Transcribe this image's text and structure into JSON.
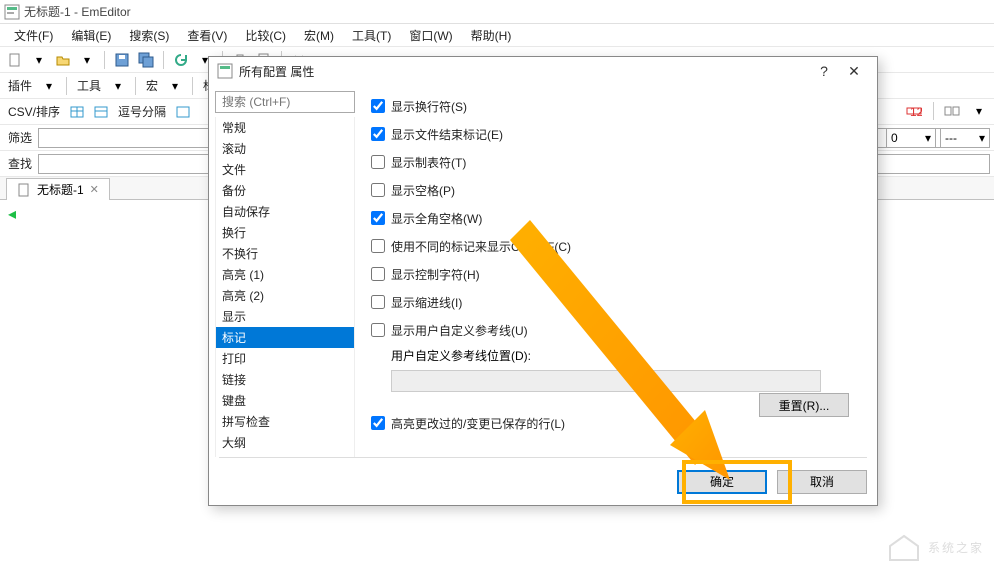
{
  "window": {
    "title": "无标题-1 - EmEditor"
  },
  "menu": {
    "items": [
      "文件(F)",
      "编辑(E)",
      "搜索(S)",
      "查看(V)",
      "比较(C)",
      "宏(M)",
      "工具(T)",
      "窗口(W)",
      "帮助(H)"
    ]
  },
  "toolbar2": {
    "plugins": "插件",
    "tools": "工具",
    "macro": "宏",
    "marker": "标"
  },
  "toolbar3": {
    "csv": "CSV/排序",
    "csvsep": "逗号分隔"
  },
  "toolbar4": {
    "filter": "筛选"
  },
  "toolbar5": {
    "find": "查找"
  },
  "tab": {
    "label": "无标题-1"
  },
  "right_widgets": {
    "num": "0",
    "dash": "---"
  },
  "dialog": {
    "title": "所有配置 属性",
    "search_placeholder": "搜索 (Ctrl+F)",
    "categories": [
      "常规",
      "滚动",
      "文件",
      "备份",
      "自动保存",
      "换行",
      "不换行",
      "高亮 (1)",
      "高亮 (2)",
      "显示",
      "标记",
      "打印",
      "链接",
      "键盘",
      "拼写检查",
      "大纲"
    ],
    "selected_index": 10,
    "options": [
      {
        "label": "显示换行符(S)",
        "checked": true
      },
      {
        "label": "显示文件结束标记(E)",
        "checked": true
      },
      {
        "label": "显示制表符(T)",
        "checked": false
      },
      {
        "label": "显示空格(P)",
        "checked": false
      },
      {
        "label": "显示全角空格(W)",
        "checked": true
      },
      {
        "label": "使用不同的标记来显示CR与LF(C)",
        "checked": false
      },
      {
        "label": "显示控制字符(H)",
        "checked": false
      },
      {
        "label": "显示缩进线(I)",
        "checked": false
      },
      {
        "label": "显示用户自定义参考线(U)",
        "checked": false
      }
    ],
    "guide_label": "用户自定义参考线位置(D):",
    "highlight_changed": {
      "label": "高亮更改过的/变更已保存的行(L)",
      "checked": true
    },
    "reset": "重置(R)...",
    "ok": "确定",
    "cancel": "取消"
  },
  "watermark": "系统之家"
}
